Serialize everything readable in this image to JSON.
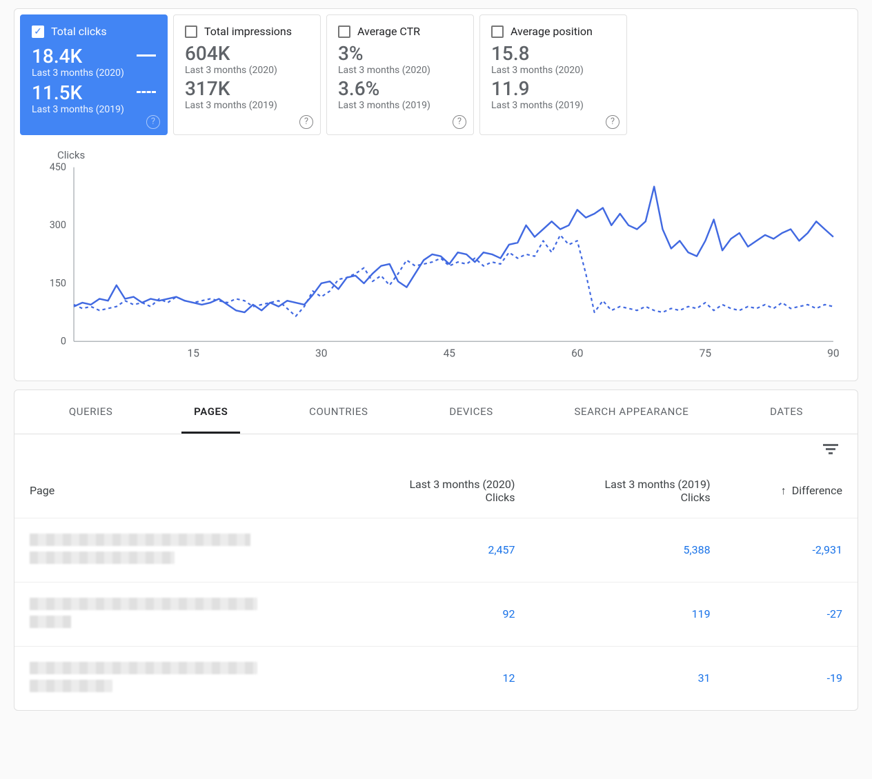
{
  "metrics": {
    "period_a_label": "Last 3 months (2020)",
    "period_b_label": "Last 3 months (2019)",
    "cards": [
      {
        "key": "total_clicks",
        "title": "Total clicks",
        "value_a": "18.4K",
        "value_b": "11.5K",
        "selected": true
      },
      {
        "key": "total_impressions",
        "title": "Total impressions",
        "value_a": "604K",
        "value_b": "317K",
        "selected": false
      },
      {
        "key": "average_ctr",
        "title": "Average CTR",
        "value_a": "3%",
        "value_b": "3.6%",
        "selected": false
      },
      {
        "key": "average_position",
        "title": "Average position",
        "value_a": "15.8",
        "value_b": "11.9",
        "selected": false
      }
    ]
  },
  "chart_data": {
    "type": "line",
    "title": "Clicks",
    "ylabel": "",
    "xlabel": "",
    "ylim": [
      0,
      450
    ],
    "y_ticks": [
      0,
      150,
      300,
      450
    ],
    "x_ticks": [
      15,
      30,
      45,
      60,
      75,
      90
    ],
    "x": [
      1,
      2,
      3,
      4,
      5,
      6,
      7,
      8,
      9,
      10,
      11,
      12,
      13,
      14,
      15,
      16,
      17,
      18,
      19,
      20,
      21,
      22,
      23,
      24,
      25,
      26,
      27,
      28,
      29,
      30,
      31,
      32,
      33,
      34,
      35,
      36,
      37,
      38,
      39,
      40,
      41,
      42,
      43,
      44,
      45,
      46,
      47,
      48,
      49,
      50,
      51,
      52,
      53,
      54,
      55,
      56,
      57,
      58,
      59,
      60,
      61,
      62,
      63,
      64,
      65,
      66,
      67,
      68,
      69,
      70,
      71,
      72,
      73,
      74,
      75,
      76,
      77,
      78,
      79,
      80,
      81,
      82,
      83,
      84,
      85,
      86,
      87,
      88,
      89,
      90
    ],
    "series": [
      {
        "name": "Last 3 months (2020)",
        "style": "solid",
        "values": [
          90,
          100,
          95,
          110,
          105,
          145,
          110,
          115,
          100,
          110,
          105,
          110,
          115,
          105,
          100,
          95,
          100,
          110,
          95,
          80,
          75,
          95,
          80,
          100,
          90,
          105,
          100,
          95,
          120,
          150,
          155,
          135,
          165,
          170,
          150,
          175,
          195,
          200,
          155,
          140,
          175,
          210,
          225,
          220,
          200,
          230,
          225,
          205,
          230,
          225,
          215,
          250,
          255,
          300,
          270,
          290,
          310,
          290,
          300,
          340,
          320,
          330,
          345,
          300,
          330,
          300,
          290,
          310,
          400,
          290,
          240,
          260,
          230,
          220,
          260,
          315,
          235,
          265,
          280,
          245,
          260,
          275,
          265,
          280,
          290,
          260,
          280,
          310,
          290,
          270
        ]
      },
      {
        "name": "Last 3 months (2019)",
        "style": "dashed",
        "values": [
          95,
          85,
          90,
          80,
          85,
          90,
          105,
          95,
          100,
          90,
          110,
          100,
          115,
          105,
          100,
          105,
          110,
          105,
          100,
          110,
          105,
          90,
          95,
          100,
          105,
          85,
          65,
          90,
          130,
          115,
          130,
          160,
          165,
          175,
          190,
          155,
          170,
          145,
          175,
          210,
          195,
          200,
          205,
          215,
          195,
          205,
          200,
          215,
          195,
          205,
          200,
          230,
          215,
          225,
          220,
          260,
          230,
          275,
          250,
          260,
          175,
          75,
          105,
          80,
          90,
          85,
          80,
          90,
          80,
          75,
          85,
          80,
          90,
          85,
          100,
          80,
          95,
          85,
          80,
          90,
          85,
          95,
          85,
          100,
          85,
          90,
          95,
          85,
          95,
          90
        ]
      }
    ]
  },
  "tabs": [
    "QUERIES",
    "PAGES",
    "COUNTRIES",
    "DEVICES",
    "SEARCH APPEARANCE",
    "DATES"
  ],
  "active_tab": "PAGES",
  "table": {
    "columns": {
      "page": "Page",
      "period_a": {
        "line1": "Last 3 months (2020)",
        "line2": "Clicks"
      },
      "period_b": {
        "line1": "Last 3 months (2019)",
        "line2": "Clicks"
      },
      "difference": "Difference",
      "sort_dir": "asc"
    },
    "rows": [
      {
        "page_redacted": true,
        "clicks_a": "2,457",
        "clicks_b": "5,388",
        "difference": "-2,931"
      },
      {
        "page_redacted": true,
        "clicks_a": "92",
        "clicks_b": "119",
        "difference": "-27"
      },
      {
        "page_redacted": true,
        "clicks_a": "12",
        "clicks_b": "31",
        "difference": "-19"
      }
    ]
  }
}
